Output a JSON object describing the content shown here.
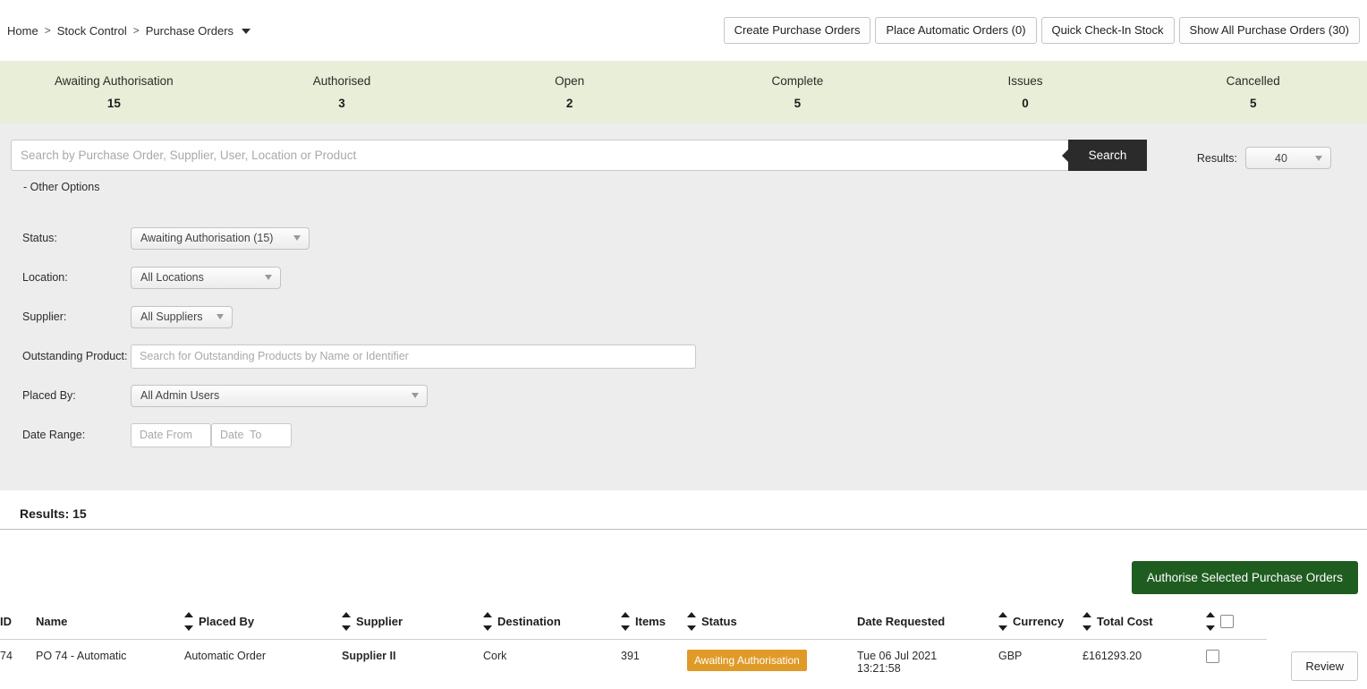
{
  "breadcrumb": {
    "items": [
      "Home",
      "Stock Control",
      "Purchase Orders"
    ],
    "separator": ">",
    "dropdown_icon": "chevron-down-icon"
  },
  "toolbar": {
    "buttons": [
      "Create Purchase Orders",
      "Place Automatic Orders (0)",
      "Quick Check-In Stock",
      "Show All Purchase Orders (30)"
    ]
  },
  "summary": {
    "background_color": "#e8eed7",
    "cells": [
      {
        "label": "Awaiting Authorisation",
        "value": "15"
      },
      {
        "label": "Authorised",
        "value": "3"
      },
      {
        "label": "Open",
        "value": "2"
      },
      {
        "label": "Complete",
        "value": "5"
      },
      {
        "label": "Issues",
        "value": "0"
      },
      {
        "label": "Cancelled",
        "value": "5"
      }
    ]
  },
  "search": {
    "placeholder": "Search by Purchase Order, Supplier, User, Location or Product",
    "value": "",
    "button_label": "Search",
    "button_color": "#2b2b2b",
    "results_label": "Results:",
    "results_value": "40"
  },
  "other_options_label": "- Other Options",
  "filters": {
    "status": {
      "label": "Status:",
      "value": "Awaiting Authorisation (15)"
    },
    "location": {
      "label": "Location:",
      "value": "All Locations"
    },
    "supplier": {
      "label": "Supplier:",
      "value": "All Suppliers"
    },
    "outstanding_product": {
      "label": "Outstanding Product:",
      "placeholder": "Search for Outstanding Products by Name or Identifier",
      "value": ""
    },
    "placed_by": {
      "label": "Placed By:",
      "value": "All Admin Users"
    },
    "date_range": {
      "label": "Date Range:",
      "from_placeholder": "Date From",
      "to_placeholder": "Date  To",
      "from_value": "",
      "to_value": ""
    }
  },
  "results": {
    "heading": "Results: 15",
    "authorise_button": "Authorise Selected Purchase Orders",
    "authorise_button_color": "#1f5c20"
  },
  "table": {
    "columns": [
      {
        "label": "ID",
        "sortable": false
      },
      {
        "label": "Name",
        "sortable": false
      },
      {
        "label": "Placed By",
        "sortable": true
      },
      {
        "label": "Supplier",
        "sortable": true
      },
      {
        "label": "Destination",
        "sortable": true
      },
      {
        "label": "Items",
        "sortable": true
      },
      {
        "label": "Status",
        "sortable": true
      },
      {
        "label": "Date Requested",
        "sortable": false
      },
      {
        "label": "Currency",
        "sortable": true
      },
      {
        "label": "Total Cost",
        "sortable": true
      }
    ],
    "select_all_checkbox": "checkbox-icon",
    "rows": [
      {
        "id": "74",
        "name": "PO 74 - Automatic",
        "placed_by": "Automatic Order",
        "supplier": "Supplier II",
        "destination": "Cork",
        "items": "391",
        "status": "Awaiting Authorisation",
        "status_color": "#e09a28",
        "date_requested_date": "Tue 06 Jul 2021",
        "date_requested_time": "13:21:58",
        "currency": "GBP",
        "total_cost": "£161293.20",
        "action_label": "Review"
      }
    ]
  }
}
